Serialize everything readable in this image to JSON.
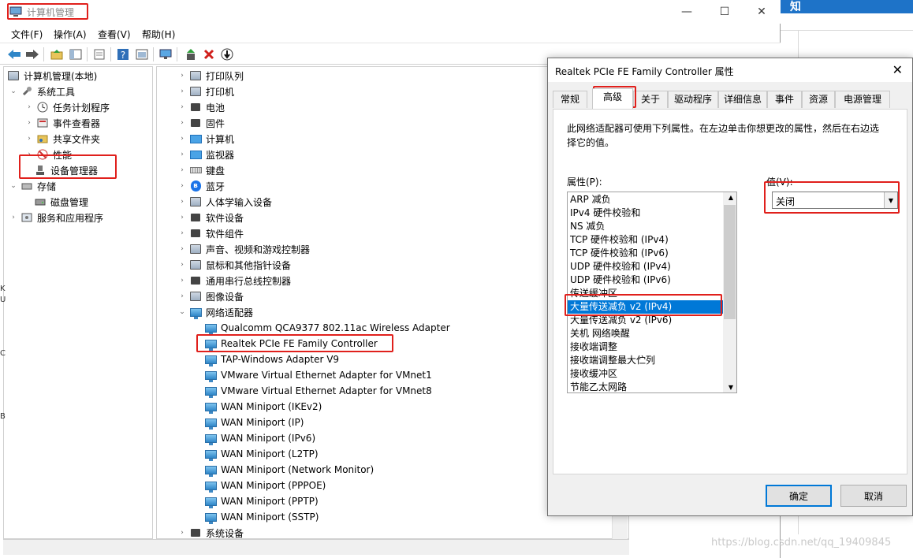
{
  "window": {
    "title": "计算机管理",
    "menu": [
      "文件(F)",
      "操作(A)",
      "查看(V)",
      "帮助(H)"
    ],
    "controls": {
      "minimize": "—",
      "maximize": "☐",
      "close": "✕"
    }
  },
  "background": {
    "fragment": "知",
    "edge_chars": [
      "K",
      "U",
      "C",
      "B"
    ]
  },
  "left_tree": {
    "root": "计算机管理(本地)",
    "system_tools": "系统工具",
    "task_scheduler": "任务计划程序",
    "event_viewer": "事件查看器",
    "shared_folders": "共享文件夹",
    "performance": "性能",
    "device_manager": "设备管理器",
    "storage": "存储",
    "disk_management": "磁盘管理",
    "services_apps": "服务和应用程序"
  },
  "devices": {
    "categories": [
      "打印队列",
      "打印机",
      "电池",
      "固件",
      "计算机",
      "监视器",
      "键盘",
      "蓝牙",
      "人体学输入设备",
      "软件设备",
      "软件组件",
      "声音、视频和游戏控制器",
      "鼠标和其他指针设备",
      "通用串行总线控制器",
      "图像设备",
      "网络适配器"
    ],
    "adapters": [
      "Qualcomm QCA9377 802.11ac Wireless Adapter",
      "Realtek PCIe FE Family Controller",
      "TAP-Windows Adapter V9",
      "VMware Virtual Ethernet Adapter for VMnet1",
      "VMware Virtual Ethernet Adapter for VMnet8",
      "WAN Miniport (IKEv2)",
      "WAN Miniport (IP)",
      "WAN Miniport (IPv6)",
      "WAN Miniport (L2TP)",
      "WAN Miniport (Network Monitor)",
      "WAN Miniport (PPPOE)",
      "WAN Miniport (PPTP)",
      "WAN Miniport (SSTP)"
    ],
    "last_category": "系统设备"
  },
  "dialog": {
    "title": "Realtek PCIe FE Family Controller 属性",
    "close": "✕",
    "tabs": [
      "常规",
      "高级",
      "关于",
      "驱动程序",
      "详细信息",
      "事件",
      "资源",
      "电源管理"
    ],
    "active_tab": "高级",
    "description": "此网络适配器可使用下列属性。在左边单击你想更改的属性，然后在右边选择它的值。",
    "property_label": "属性(P):",
    "value_label": "值(V):",
    "properties": [
      "ARP 减负",
      "IPv4 硬件校验和",
      "NS 减负",
      "TCP 硬件校验和 (IPv4)",
      "TCP 硬件校验和 (IPv6)",
      "UDP 硬件校验和 (IPv4)",
      "UDP 硬件校验和 (IPv6)",
      "传送缓冲区",
      "大量传送减负 v2 (IPv4)",
      "大量传送减负 v2 (IPv6)",
      "关机 网络唤醒",
      "接收端调整",
      "接收端调整最大伫列",
      "接收缓冲区",
      "节能乙太网路"
    ],
    "selected_property": "大量传送减负 v2 (IPv4)",
    "value": "关闭",
    "ok": "确定",
    "cancel": "取消"
  },
  "watermark": "https://blog.csdn.net/qq_19409845",
  "colors": {
    "highlight_red": "#e0201c",
    "selection_blue": "#0078d7"
  }
}
